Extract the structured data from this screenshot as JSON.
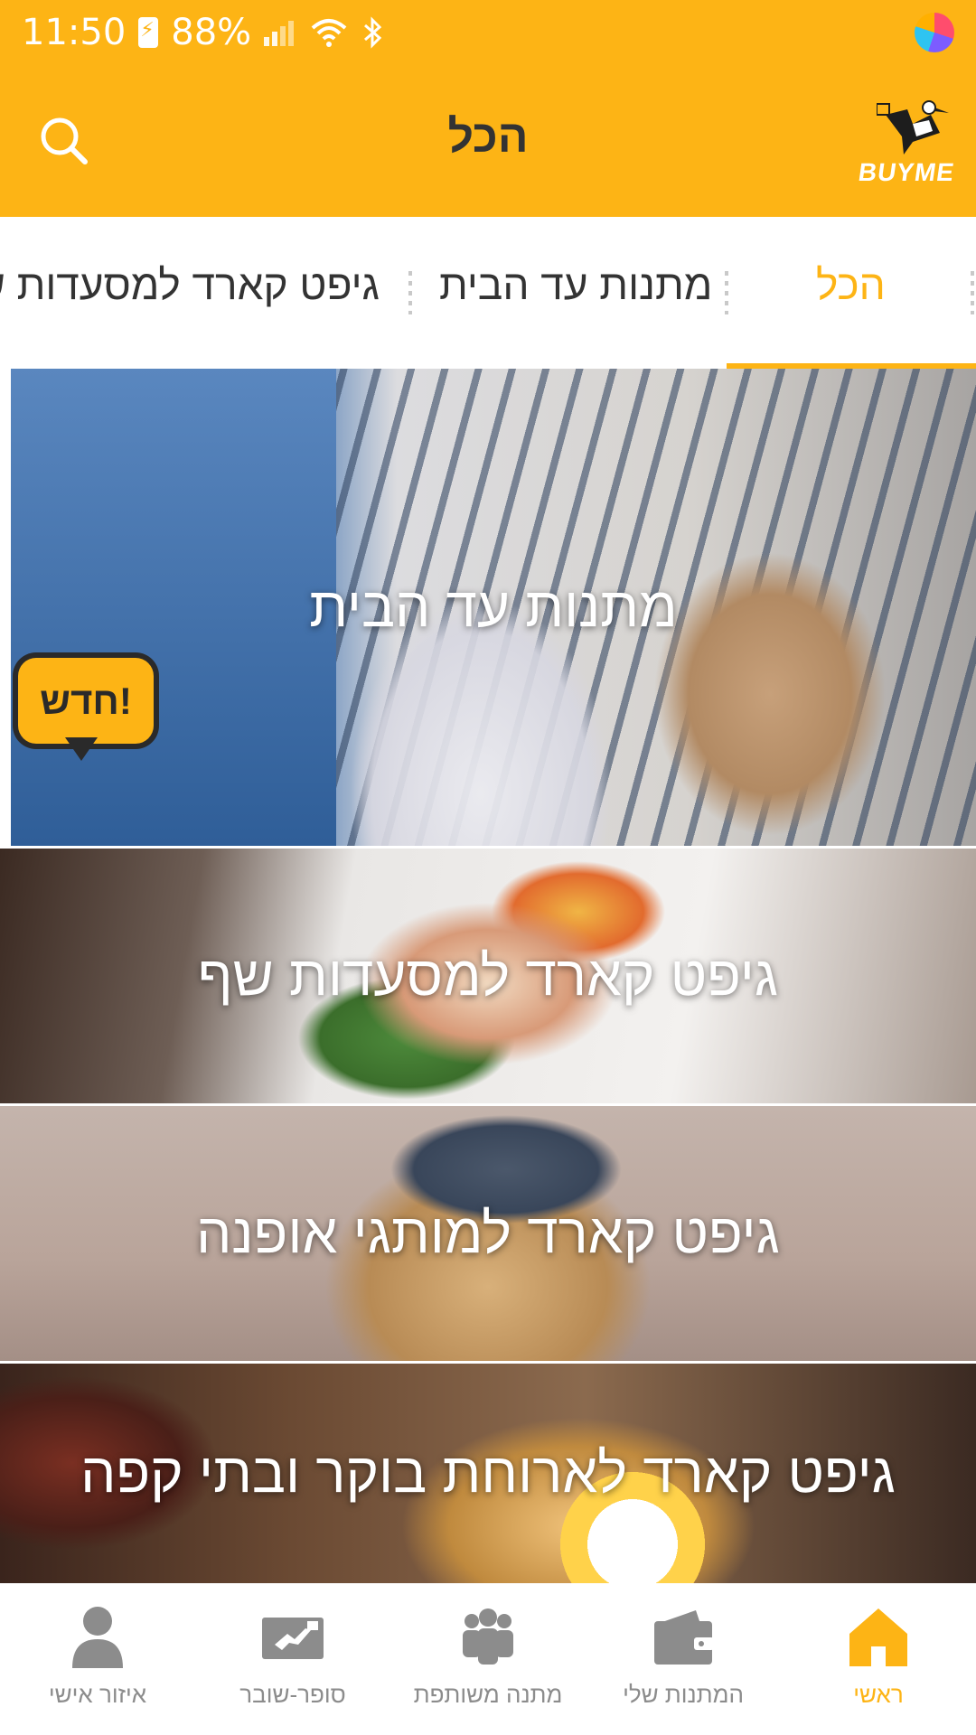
{
  "status_bar": {
    "time": "11:50",
    "battery": "88%"
  },
  "app_bar": {
    "title": "הכל",
    "logo_text": "BUYME"
  },
  "tabs": [
    {
      "label": "הכל",
      "active": true
    },
    {
      "label": "מתנות עד הבית",
      "active": false
    },
    {
      "label": "גיפט קארד למסעדות שף",
      "active": false
    }
  ],
  "banners": [
    {
      "label": "מתנות עד הבית",
      "badge": "חדש!"
    },
    {
      "label": "גיפט קארד למסעדות שף"
    },
    {
      "label": "גיפט קארד למותגי אופנה"
    },
    {
      "label": "גיפט קארד לארוחת בוקר ובתי קפה"
    }
  ],
  "bottom_nav": [
    {
      "label": "ראשי",
      "icon": "home-icon",
      "active": true
    },
    {
      "label": "המתנות שלי",
      "icon": "wallet-icon",
      "active": false
    },
    {
      "label": "מתנה משותפת",
      "icon": "group-icon",
      "active": false
    },
    {
      "label": "סופר-שובר",
      "icon": "voucher-icon",
      "active": false
    },
    {
      "label": "איזור אישי",
      "icon": "person-icon",
      "active": false
    }
  ],
  "colors": {
    "accent": "#fdb415",
    "nav_inactive": "#8c8c8c",
    "title_text": "#333333"
  }
}
